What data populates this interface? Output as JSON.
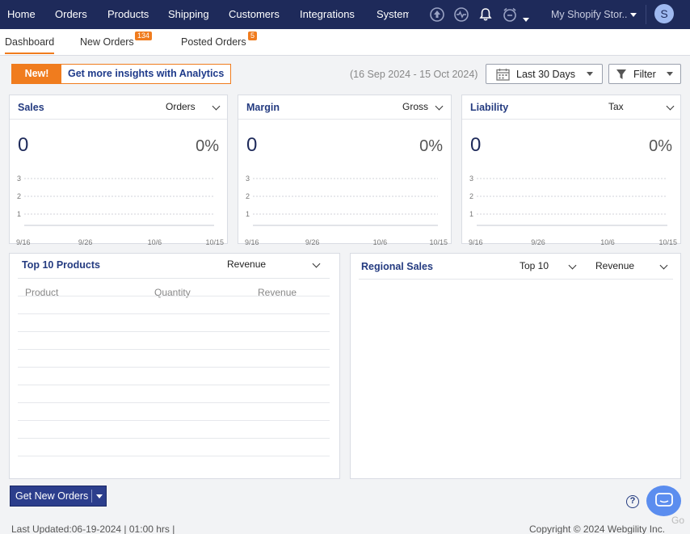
{
  "nav": {
    "items": [
      {
        "label": "Home"
      },
      {
        "label": "Orders"
      },
      {
        "label": "Products"
      },
      {
        "label": "Shipping"
      },
      {
        "label": "Customers"
      },
      {
        "label": "Integrations"
      },
      {
        "label": "System"
      }
    ],
    "icons": [
      "upload-icon",
      "activity-icon",
      "bell-icon",
      "alarm-clock-icon"
    ],
    "store": "My Shopify Stor..",
    "avatar_letter": "S"
  },
  "tabs": [
    {
      "label": "Dashboard",
      "badge": ""
    },
    {
      "label": "New Orders",
      "badge": "134"
    },
    {
      "label": "Posted Orders",
      "badge": "5"
    }
  ],
  "promo": {
    "new_label": "New!",
    "text": "Get more insights with Analytics"
  },
  "date_range": "(16 Sep 2024 - 15 Oct 2024)",
  "period_select": "Last 30 Days",
  "filter_label": "Filter",
  "cards": [
    {
      "title": "Sales",
      "select": "Orders",
      "value": "0",
      "percent": "0%"
    },
    {
      "title": "Margin",
      "select": "Gross",
      "value": "0",
      "percent": "0%"
    },
    {
      "title": "Liability",
      "select": "Tax",
      "value": "0",
      "percent": "0%"
    }
  ],
  "chart_data": [
    {
      "type": "line",
      "title": "Sales",
      "x": [
        "9/16",
        "9/26",
        "10/6",
        "10/15"
      ],
      "yticks": [
        1,
        2,
        3
      ],
      "series": []
    },
    {
      "type": "line",
      "title": "Margin",
      "x": [
        "9/16",
        "9/26",
        "10/6",
        "10/15"
      ],
      "yticks": [
        1,
        2,
        3
      ],
      "series": []
    },
    {
      "type": "line",
      "title": "Liability",
      "x": [
        "9/16",
        "9/26",
        "10/6",
        "10/15"
      ],
      "yticks": [
        1,
        2,
        3
      ],
      "series": []
    }
  ],
  "top_products": {
    "title": "Top 10 Products",
    "select": "Revenue",
    "columns": [
      "Product",
      "Quantity",
      "Revenue"
    ]
  },
  "regional": {
    "title": "Regional Sales",
    "select_count": "Top 10",
    "select_metric": "Revenue"
  },
  "get_orders_label": "Get New Orders",
  "help_label": "?",
  "footer": {
    "last_updated": "Last Updated:06-19-2024 | 01:00 hrs |",
    "copyright": "Copyright © 2024 Webgility Inc.",
    "go": "Go"
  },
  "colors": {
    "nav_bg": "#1e2a5a",
    "accent": "#f07c1e",
    "title_blue": "#243b80",
    "chat_blue": "#5b8def"
  }
}
